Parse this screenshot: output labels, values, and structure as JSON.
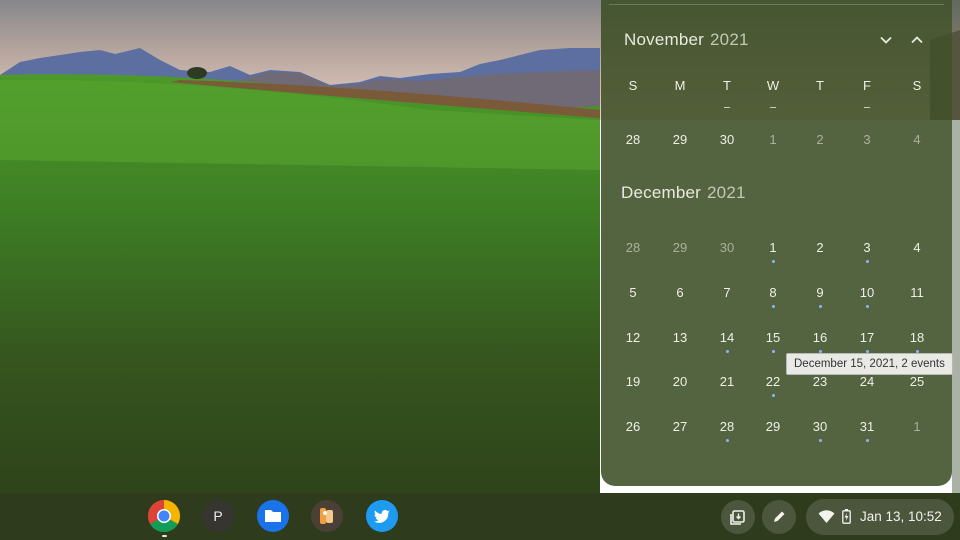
{
  "calendar": {
    "months": [
      {
        "name": "November",
        "year": "2021",
        "weekday_headers": [
          "S",
          "M",
          "T",
          "W",
          "T",
          "F",
          "S"
        ],
        "rows": [
          [
            {
              "d": "28",
              "dim": false,
              "dot": false
            },
            {
              "d": "29",
              "dim": false,
              "dot": false
            },
            {
              "d": "30",
              "dim": false,
              "dot": false
            },
            {
              "d": "1",
              "dim": true,
              "dot": false
            },
            {
              "d": "2",
              "dim": true,
              "dot": false
            },
            {
              "d": "3",
              "dim": true,
              "dot": false
            },
            {
              "d": "4",
              "dim": true,
              "dot": false
            }
          ]
        ]
      },
      {
        "name": "December",
        "year": "2021",
        "rows": [
          [
            {
              "d": "28",
              "dim": true,
              "dot": false
            },
            {
              "d": "29",
              "dim": true,
              "dot": false
            },
            {
              "d": "30",
              "dim": true,
              "dot": false
            },
            {
              "d": "1",
              "dim": false,
              "dot": true
            },
            {
              "d": "2",
              "dim": false,
              "dot": false
            },
            {
              "d": "3",
              "dim": false,
              "dot": true
            },
            {
              "d": "4",
              "dim": false,
              "dot": false
            }
          ],
          [
            {
              "d": "5",
              "dim": false,
              "dot": false
            },
            {
              "d": "6",
              "dim": false,
              "dot": false
            },
            {
              "d": "7",
              "dim": false,
              "dot": false
            },
            {
              "d": "8",
              "dim": false,
              "dot": true
            },
            {
              "d": "9",
              "dim": false,
              "dot": true
            },
            {
              "d": "10",
              "dim": false,
              "dot": true
            },
            {
              "d": "11",
              "dim": false,
              "dot": false
            }
          ],
          [
            {
              "d": "12",
              "dim": false,
              "dot": false
            },
            {
              "d": "13",
              "dim": false,
              "dot": false
            },
            {
              "d": "14",
              "dim": false,
              "dot": true
            },
            {
              "d": "15",
              "dim": false,
              "dot": true
            },
            {
              "d": "16",
              "dim": false,
              "dot": true
            },
            {
              "d": "17",
              "dim": false,
              "dot": true
            },
            {
              "d": "18",
              "dim": false,
              "dot": true
            }
          ],
          [
            {
              "d": "19",
              "dim": false,
              "dot": false
            },
            {
              "d": "20",
              "dim": false,
              "dot": false
            },
            {
              "d": "21",
              "dim": false,
              "dot": false
            },
            {
              "d": "22",
              "dim": false,
              "dot": true
            },
            {
              "d": "23",
              "dim": false,
              "dot": false
            },
            {
              "d": "24",
              "dim": false,
              "dot": false
            },
            {
              "d": "25",
              "dim": false,
              "dot": false
            }
          ],
          [
            {
              "d": "26",
              "dim": false,
              "dot": false
            },
            {
              "d": "27",
              "dim": false,
              "dot": false
            },
            {
              "d": "28",
              "dim": false,
              "dot": true
            },
            {
              "d": "29",
              "dim": false,
              "dot": false
            },
            {
              "d": "30",
              "dim": false,
              "dot": true
            },
            {
              "d": "31",
              "dim": false,
              "dot": true
            },
            {
              "d": "1",
              "dim": true,
              "dot": false
            }
          ]
        ]
      }
    ],
    "tooltip": "December 15, 2021, 2 events",
    "nav": {
      "down_icon": "chevron-down-icon",
      "up_icon": "chevron-up-icon"
    }
  },
  "shelf": {
    "apps": [
      {
        "name": "chrome-app-icon"
      },
      {
        "name": "p-app-icon",
        "letter": "P"
      },
      {
        "name": "files-app-icon"
      },
      {
        "name": "photo-app-icon"
      },
      {
        "name": "twitter-app-icon"
      }
    ],
    "tray": [
      {
        "name": "holding-space-icon"
      },
      {
        "name": "stylus-tools-icon"
      }
    ],
    "status": {
      "wifi_icon": "wifi-icon",
      "battery_icon": "battery-charging-icon",
      "datetime": "Jan 13, 10:52"
    }
  },
  "colors": {
    "event_dot": "#8ab4f8",
    "panel": "#3e4e26",
    "shelf": "#2f3b1d"
  }
}
